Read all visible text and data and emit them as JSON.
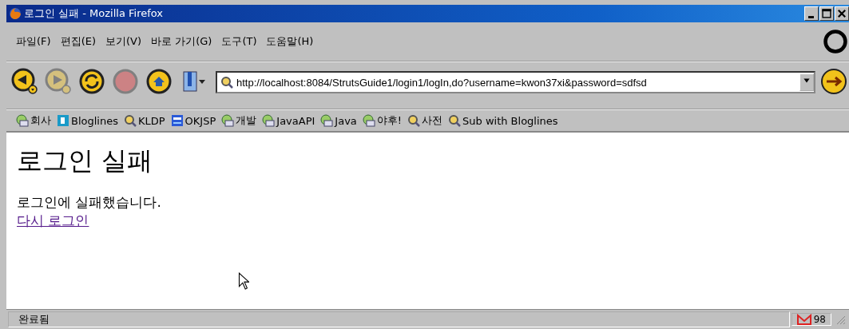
{
  "window": {
    "title": "로그인 실패 - Mozilla Firefox"
  },
  "menu": [
    "파일(F)",
    "편집(E)",
    "보기(V)",
    "바로 가기(G)",
    "도구(T)",
    "도움말(H)"
  ],
  "navigation": {
    "back_disabled": false,
    "forward_disabled": true,
    "stop_disabled": true,
    "url": "http://localhost:8084/StrutsGuide1/login1/logIn,do?username=kwon37xi&password=sdfsd"
  },
  "bookmarks": [
    {
      "label": "회사",
      "kind": "folder"
    },
    {
      "label": "Bloglines",
      "kind": "bloglines"
    },
    {
      "label": "KLDP",
      "kind": "feed"
    },
    {
      "label": "OKJSP",
      "kind": "okjsp"
    },
    {
      "label": "개발",
      "kind": "folder"
    },
    {
      "label": "JavaAPI",
      "kind": "folder"
    },
    {
      "label": "Java",
      "kind": "folder"
    },
    {
      "label": "야후!",
      "kind": "folder"
    },
    {
      "label": "사전",
      "kind": "feed"
    },
    {
      "label": "Sub with Bloglines",
      "kind": "feed"
    }
  ],
  "page": {
    "heading": "로그인 실패",
    "message": "로그인에 실패했습니다.",
    "link": "다시 로그인"
  },
  "status_bar": {
    "text": "완료됨",
    "mail_count": "98"
  }
}
